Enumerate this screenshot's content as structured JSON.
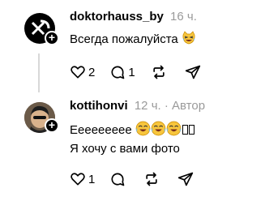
{
  "comments": [
    {
      "username": "doktorhauss_by",
      "time": "16 ч.",
      "text": "Всегда пожалуйста",
      "likes": "2",
      "replies": "1"
    },
    {
      "username": "kottihonvi",
      "time": "12 ч.",
      "tag": "Автор",
      "text_line1": "Еееееееее",
      "text_line2": "Я хочу с вами фото",
      "likes": "1"
    }
  ]
}
